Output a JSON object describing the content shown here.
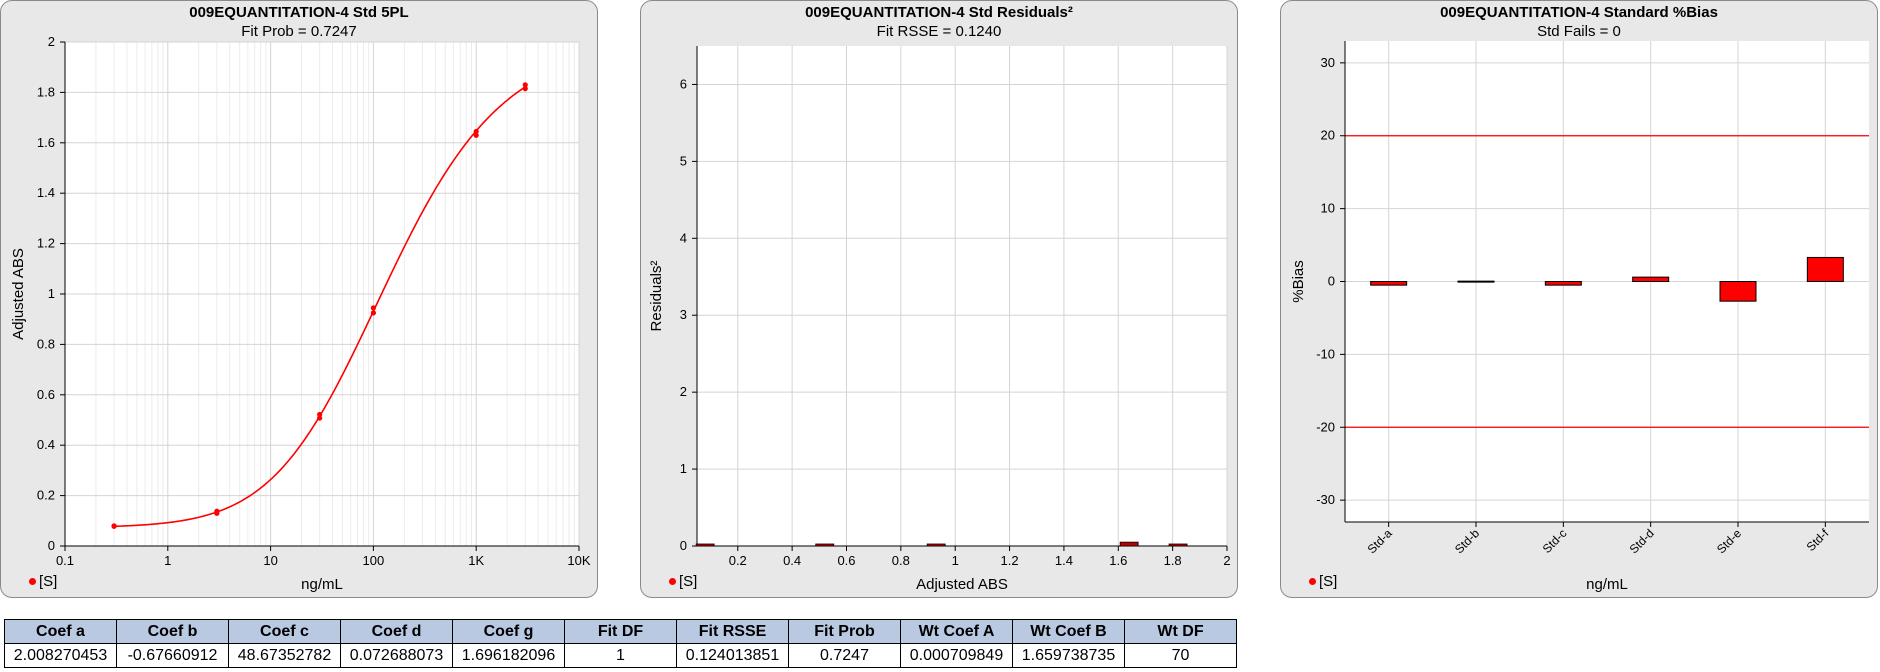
{
  "chart_data": [
    {
      "type": "scatter",
      "title": "009EQUANTITATION-4 Std 5PL",
      "subtitle": "Fit Prob = 0.7247",
      "xlabel": "ng/mL",
      "ylabel": "Adjusted ABS",
      "xscale": "log",
      "xlim": [
        0.1,
        10000
      ],
      "ylim": [
        0,
        2
      ],
      "xticks": [
        0.1,
        1,
        10,
        100,
        1000,
        10000
      ],
      "xtick_labels": [
        "0.1",
        "1",
        "10",
        "100",
        "1K",
        "10K"
      ],
      "yticks": [
        0,
        0.2,
        0.4,
        0.6,
        0.8,
        1,
        1.2,
        1.4,
        1.6,
        1.8,
        2
      ],
      "ytick_labels": [
        "0",
        "0.2",
        "0.4",
        "0.6",
        "0.8",
        "1",
        "1.2",
        "1.4",
        "1.6",
        "1.8",
        "2"
      ],
      "grid": true,
      "series": [
        {
          "name": "[S]",
          "x": [
            0.3,
            0.3,
            3,
            3,
            30,
            30,
            100,
            100,
            1000,
            1000,
            3000,
            3000
          ],
          "y": [
            0.078,
            0.08,
            0.13,
            0.138,
            0.508,
            0.522,
            0.925,
            0.945,
            1.63,
            1.645,
            1.815,
            1.83
          ]
        }
      ],
      "fit": {
        "model": "5PL",
        "a": 2.008270453,
        "b": -0.67660912,
        "c": 48.67352782,
        "d": 0.072688073,
        "g": 1.696182096,
        "x_range": [
          0.3,
          3000
        ]
      },
      "color": "#ff0000",
      "legend": "bottom-left"
    },
    {
      "type": "bar",
      "title": "009EQUANTITATION-4 Std  Residuals²",
      "subtitle": "Fit RSSE = 0.1240",
      "xlabel": "Adjusted ABS",
      "ylabel": "Residuals²",
      "xlim": [
        0.05,
        2.0
      ],
      "ylim": [
        0,
        6.5
      ],
      "xticks": [
        0.2,
        0.4,
        0.6,
        0.8,
        1,
        1.2,
        1.4,
        1.6,
        1.8,
        2
      ],
      "xtick_labels": [
        "0.2",
        "0.4",
        "0.6",
        "0.8",
        "1",
        "1.2",
        "1.4",
        "1.6",
        "1.8",
        "2"
      ],
      "yticks": [
        0,
        1,
        2,
        3,
        4,
        5,
        6
      ],
      "ytick_labels": [
        "0",
        "1",
        "2",
        "3",
        "4",
        "5",
        "6"
      ],
      "grid": true,
      "x": [
        0.08,
        0.52,
        0.93,
        1.64,
        1.82
      ],
      "values": [
        0.005,
        0.005,
        0.025,
        0.05,
        0.005
      ],
      "color": "#c00000",
      "legend_label": "[S]",
      "legend": "bottom-left"
    },
    {
      "type": "bar",
      "title": "009EQUANTITATION-4 Standard %Bias",
      "subtitle": "Std Fails = 0",
      "xlabel": "ng/mL",
      "ylabel": "%Bias",
      "ylim": [
        -33,
        33
      ],
      "yticks": [
        -30,
        -20,
        -10,
        0,
        10,
        20,
        30
      ],
      "ytick_labels": [
        "-30",
        "-20",
        "-10",
        "0",
        "10",
        "20",
        "30"
      ],
      "categories": [
        "Std-a",
        "Std-b",
        "Std-c",
        "Std-d",
        "Std-e",
        "Std-f"
      ],
      "values": [
        -0.5,
        0.05,
        -0.5,
        0.6,
        -2.7,
        3.3
      ],
      "limit_lines": [
        20,
        -20
      ],
      "limit_color": "#ff0000",
      "color": "#ff0000",
      "grid": true,
      "legend_label": "[S]",
      "legend": "bottom-left"
    }
  ],
  "table": {
    "headers": [
      "Coef a",
      "Coef b",
      "Coef c",
      "Coef d",
      "Coef g",
      "Fit DF",
      "Fit RSSE",
      "Fit Prob",
      "Wt Coef A",
      "Wt Coef B",
      "Wt DF"
    ],
    "row": [
      "2.008270453",
      "-0.67660912",
      "48.67352782",
      "0.072688073",
      "1.696182096",
      "1",
      "0.124013851",
      "0.7247",
      "0.000709849",
      "1.659738735",
      "70"
    ]
  }
}
